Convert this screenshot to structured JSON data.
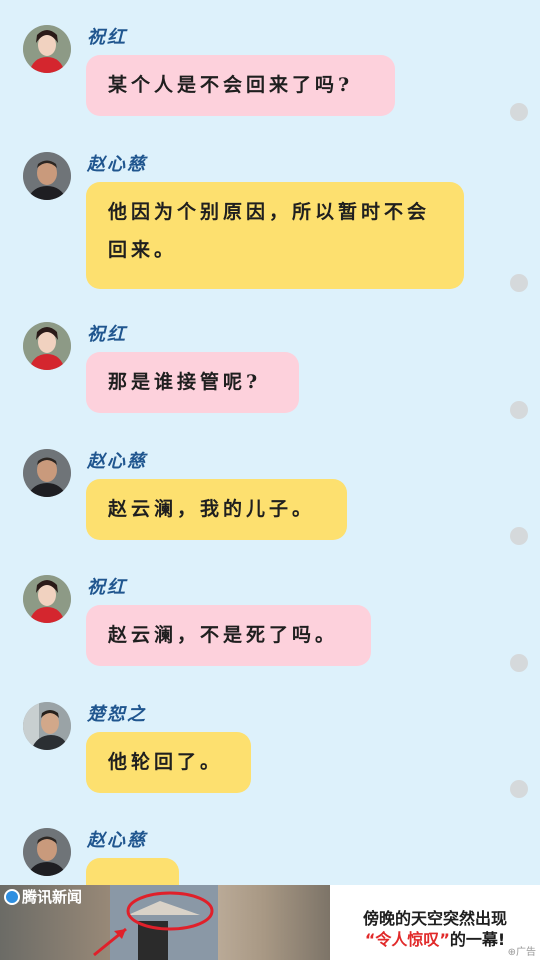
{
  "messages": [
    {
      "name": "祝红",
      "text": "某个人是不会回来了吗?",
      "color": "pink",
      "avatar": "female-avatar"
    },
    {
      "name": "赵心慈",
      "text": "他因为个别原因，所以暂时不会回来。",
      "color": "yellow",
      "avatar": "male-avatar"
    },
    {
      "name": "祝红",
      "text": "那是谁接管呢?",
      "color": "pink",
      "avatar": "female-avatar"
    },
    {
      "name": "赵心慈",
      "text": "赵云澜，我的儿子。",
      "color": "yellow",
      "avatar": "male-avatar"
    },
    {
      "name": "祝红",
      "text": "赵云澜，不是死了吗。",
      "color": "pink",
      "avatar": "female-avatar"
    },
    {
      "name": "楚恕之",
      "text": "他轮回了。",
      "color": "yellow",
      "avatar": "male-avatar-2"
    },
    {
      "name": "赵心慈",
      "text": "",
      "color": "yellow",
      "avatar": "male-avatar"
    }
  ],
  "ad": {
    "logo_text": "腾讯新闻",
    "line1": "傍晚的天空突然出现",
    "line2_quote": "“令人惊叹”",
    "line2_rest": "的一幕!",
    "label": "广告"
  },
  "colors": {
    "background": "#ddf1fb",
    "bubble_pink": "#fdd1dc",
    "bubble_yellow": "#fde06f",
    "name_blue": "#20568f",
    "ad_highlight": "#e12a2a"
  }
}
